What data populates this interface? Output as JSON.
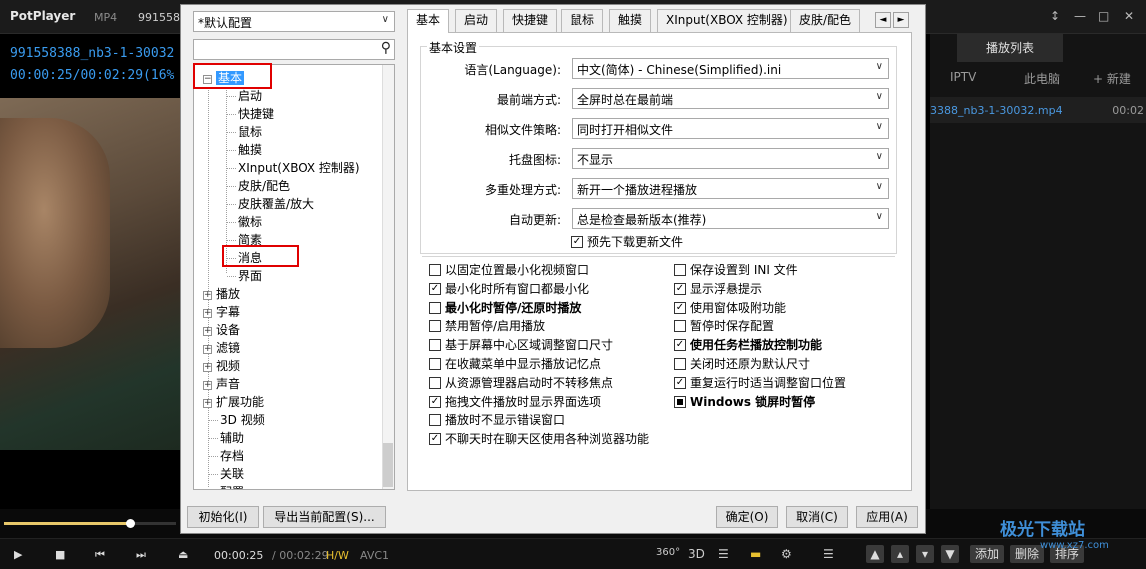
{
  "player": {
    "brand": "PotPlayer",
    "format": "MP4",
    "filename_short": "991558",
    "osd_filename": "991558388_nb3-1-30032",
    "osd_time": "00:00:25/00:02:29(16%",
    "time_current": "00:00:25",
    "time_total": "/ 00:02:29",
    "hw": "H/W",
    "codec": "AVC1",
    "progress_fraction": 0.16,
    "window_controls": [
      "↕",
      "—",
      "□",
      "✕"
    ],
    "right_icons": [
      "360°",
      "3D"
    ]
  },
  "playlist": {
    "tab": "播放列表",
    "sub_tabs": [
      "IPTV",
      "此电脑",
      "+ 新建"
    ],
    "item_name": "3388_nb3-1-30032.mp4",
    "item_time": "00:02",
    "buttons": [
      "添加",
      "删除",
      "排序"
    ]
  },
  "watermark": {
    "title": "极光下载站",
    "sub": "www.xz7.com"
  },
  "dialog": {
    "profile": "*默认配置",
    "tree_root": "基本",
    "tree_children": [
      "启动",
      "快捷键",
      "鼠标",
      "触摸",
      "XInput(XBOX 控制器)",
      "皮肤/配色",
      "皮肤覆盖/放大",
      "徽标",
      "简素",
      "消息",
      "界面"
    ],
    "tree_collapsed": [
      "播放",
      "字幕",
      "设备",
      "滤镜",
      "视频",
      "声音",
      "扩展功能"
    ],
    "tree_plain": [
      "3D 视频",
      "辅助",
      "存档",
      "关联",
      "配置"
    ],
    "tabs": [
      "基本",
      "启动",
      "快捷键",
      "鼠标",
      "触摸",
      "XInput(XBOX 控制器)",
      "皮肤/配色"
    ],
    "tab_arrows": [
      "◄",
      "►"
    ],
    "group_title": "基本设置",
    "fields": [
      {
        "label": "语言(Language):",
        "value": "中文(简体) - Chinese(Simplified).ini"
      },
      {
        "label": "最前端方式:",
        "value": "全屏时总在最前端"
      },
      {
        "label": "相似文件策略:",
        "value": "同时打开相似文件"
      },
      {
        "label": "托盘图标:",
        "value": "不显示"
      },
      {
        "label": "多重处理方式:",
        "value": "新开一个播放进程播放"
      },
      {
        "label": "自动更新:",
        "value": "总是检查最新版本(推荐)"
      }
    ],
    "predownload": {
      "label": "预先下载更新文件",
      "checked": true
    },
    "checks_left": [
      {
        "label": "以固定位置最小化视频窗口",
        "checked": false,
        "bold": false
      },
      {
        "label": "最小化时所有窗口都最小化",
        "checked": true,
        "bold": false
      },
      {
        "label": "最小化时暂停/还原时播放",
        "checked": false,
        "bold": true
      },
      {
        "label": "禁用暂停/启用播放",
        "checked": false,
        "bold": false
      },
      {
        "label": "基于屏幕中心区域调整窗口尺寸",
        "checked": false,
        "bold": false
      },
      {
        "label": "在收藏菜单中显示播放记忆点",
        "checked": false,
        "bold": false
      },
      {
        "label": "从资源管理器启动时不转移焦点",
        "checked": false,
        "bold": false
      },
      {
        "label": "拖拽文件播放时显示界面选项",
        "checked": true,
        "bold": false
      },
      {
        "label": "播放时不显示错误窗口",
        "checked": false,
        "bold": false
      },
      {
        "label": "不聊天时在聊天区使用各种浏览器功能",
        "checked": true,
        "bold": false
      }
    ],
    "checks_right": [
      {
        "label": "保存设置到 INI 文件",
        "state": "off",
        "bold": false
      },
      {
        "label": "显示浮悬提示",
        "state": "on",
        "bold": false
      },
      {
        "label": "使用窗体吸附功能",
        "state": "on",
        "bold": false
      },
      {
        "label": "暂停时保存配置",
        "state": "off",
        "bold": false
      },
      {
        "label": "使用任务栏播放控制功能",
        "state": "on",
        "bold": true
      },
      {
        "label": "关闭时还原为默认尺寸",
        "state": "off",
        "bold": false
      },
      {
        "label": "重复运行时适当调整窗口位置",
        "state": "on",
        "bold": false
      },
      {
        "label": "Windows 锁屏时暂停",
        "state": "filled",
        "bold": true
      }
    ],
    "buttons": {
      "init": "初始化(I)",
      "export": "导出当前配置(S)...",
      "ok": "确定(O)",
      "cancel": "取消(C)",
      "apply": "应用(A)"
    }
  }
}
